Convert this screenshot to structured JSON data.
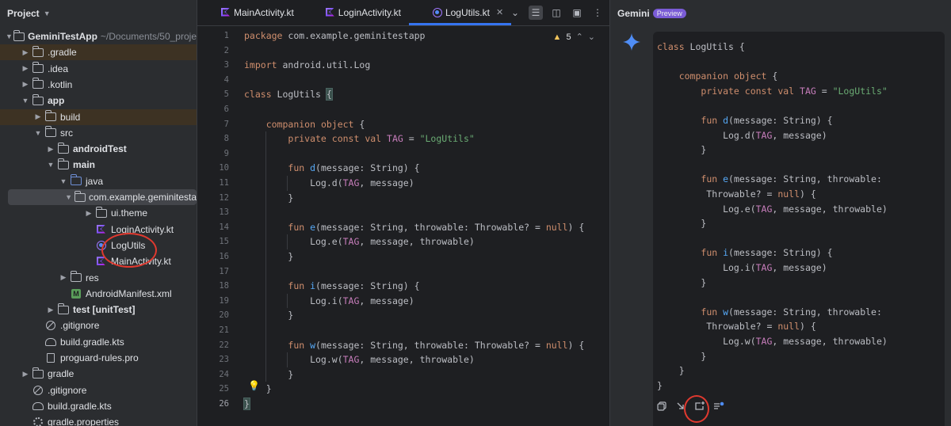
{
  "project_panel": {
    "title": "Project",
    "tree": [
      {
        "label": "GeminiTestApp",
        "path": "~/Documents/50_proje",
        "depth": 0,
        "arrow": "open",
        "icon": "module",
        "bold": true,
        "hl": ""
      },
      {
        "label": ".gradle",
        "depth": 1,
        "arrow": "closed",
        "icon": "folder",
        "hl": "orange"
      },
      {
        "label": ".idea",
        "depth": 1,
        "arrow": "closed",
        "icon": "folder",
        "hl": ""
      },
      {
        "label": ".kotlin",
        "depth": 1,
        "arrow": "closed",
        "icon": "folder",
        "hl": ""
      },
      {
        "label": "app",
        "depth": 1,
        "arrow": "open",
        "icon": "module",
        "bold": true,
        "hl": ""
      },
      {
        "label": "build",
        "depth": 2,
        "arrow": "closed",
        "icon": "folder",
        "hl": "orange"
      },
      {
        "label": "src",
        "depth": 2,
        "arrow": "open",
        "icon": "folder",
        "hl": ""
      },
      {
        "label": "androidTest",
        "depth": 3,
        "arrow": "closed",
        "icon": "folder",
        "bold": true,
        "hl": ""
      },
      {
        "label": "main",
        "depth": 3,
        "arrow": "open",
        "icon": "folder",
        "bold": true,
        "hl": ""
      },
      {
        "label": "java",
        "depth": 4,
        "arrow": "open",
        "icon": "folder-blue",
        "hl": ""
      },
      {
        "label": "com.example.geminitesta",
        "depth": 5,
        "arrow": "open",
        "icon": "folder",
        "hl": "sel"
      },
      {
        "label": "ui.theme",
        "depth": 6,
        "arrow": "closed",
        "icon": "folder",
        "hl": ""
      },
      {
        "label": "LoginActivity.kt",
        "depth": 6,
        "arrow": "none",
        "icon": "kotlin",
        "hl": ""
      },
      {
        "label": "LogUtils",
        "depth": 6,
        "arrow": "none",
        "icon": "object",
        "hl": ""
      },
      {
        "label": "MainActivity.kt",
        "depth": 6,
        "arrow": "none",
        "icon": "kotlin",
        "hl": ""
      },
      {
        "label": "res",
        "depth": 4,
        "arrow": "closed",
        "icon": "folder",
        "hl": ""
      },
      {
        "label": "AndroidManifest.xml",
        "depth": 4,
        "arrow": "none",
        "icon": "manifest",
        "hl": ""
      },
      {
        "label": "test [unitTest]",
        "depth": 3,
        "arrow": "closed",
        "icon": "folder",
        "bold": true,
        "hl": ""
      },
      {
        "label": ".gitignore",
        "depth": 2,
        "arrow": "none",
        "icon": "ban",
        "hl": ""
      },
      {
        "label": "build.gradle.kts",
        "depth": 2,
        "arrow": "none",
        "icon": "gradle",
        "hl": ""
      },
      {
        "label": "proguard-rules.pro",
        "depth": 2,
        "arrow": "none",
        "icon": "file",
        "hl": ""
      },
      {
        "label": "gradle",
        "depth": 1,
        "arrow": "closed",
        "icon": "folder",
        "hl": ""
      },
      {
        "label": ".gitignore",
        "depth": 1,
        "arrow": "none",
        "icon": "ban",
        "hl": ""
      },
      {
        "label": "build.gradle.kts",
        "depth": 1,
        "arrow": "none",
        "icon": "gradle",
        "hl": ""
      },
      {
        "label": "gradle.properties",
        "depth": 1,
        "arrow": "none",
        "icon": "gear",
        "hl": ""
      }
    ]
  },
  "editor": {
    "tabs": [
      {
        "label": "MainActivity.kt",
        "icon": "kotlin",
        "active": false
      },
      {
        "label": "LoginActivity.kt",
        "icon": "kotlin",
        "active": false
      },
      {
        "label": "LogUtils.kt",
        "icon": "object",
        "active": true
      }
    ],
    "close_glyph": "✕",
    "warnings_count": "5",
    "lines": [
      [
        [
          "kw",
          "package "
        ],
        [
          "t",
          "com.example.geminitestapp"
        ]
      ],
      [],
      [
        [
          "kw",
          "import "
        ],
        [
          "t",
          "android.util.Log"
        ]
      ],
      [],
      [
        [
          "kw",
          "class "
        ],
        [
          "t",
          "LogUtils "
        ],
        [
          "hl",
          "{"
        ]
      ],
      [],
      [
        [
          "t",
          "    "
        ],
        [
          "kw",
          "companion object "
        ],
        [
          "t",
          "{"
        ]
      ],
      [
        [
          "t",
          "        "
        ],
        [
          "kw",
          "private const val "
        ],
        [
          "const",
          "TAG"
        ],
        [
          "t",
          " = "
        ],
        [
          "str",
          "\"LogUtils\""
        ]
      ],
      [],
      [
        [
          "t",
          "        "
        ],
        [
          "kw",
          "fun "
        ],
        [
          "fn",
          "d"
        ],
        [
          "t",
          "(message: String) {"
        ]
      ],
      [
        [
          "t",
          "            Log.d("
        ],
        [
          "const",
          "TAG"
        ],
        [
          "t",
          ", message)"
        ]
      ],
      [
        [
          "t",
          "        }"
        ]
      ],
      [],
      [
        [
          "t",
          "        "
        ],
        [
          "kw",
          "fun "
        ],
        [
          "fn",
          "e"
        ],
        [
          "t",
          "(message: String, throwable: Throwable? = "
        ],
        [
          "kw",
          "null"
        ],
        [
          "t",
          ") {"
        ]
      ],
      [
        [
          "t",
          "            Log.e("
        ],
        [
          "const",
          "TAG"
        ],
        [
          "t",
          ", message, throwable)"
        ]
      ],
      [
        [
          "t",
          "        }"
        ]
      ],
      [],
      [
        [
          "t",
          "        "
        ],
        [
          "kw",
          "fun "
        ],
        [
          "fn",
          "i"
        ],
        [
          "t",
          "(message: String) {"
        ]
      ],
      [
        [
          "t",
          "            Log.i("
        ],
        [
          "const",
          "TAG"
        ],
        [
          "t",
          ", message)"
        ]
      ],
      [
        [
          "t",
          "        }"
        ]
      ],
      [],
      [
        [
          "t",
          "        "
        ],
        [
          "kw",
          "fun "
        ],
        [
          "fn",
          "w"
        ],
        [
          "t",
          "(message: String, throwable: Throwable? = "
        ],
        [
          "kw",
          "null"
        ],
        [
          "t",
          ") {"
        ]
      ],
      [
        [
          "t",
          "            Log.w("
        ],
        [
          "const",
          "TAG"
        ],
        [
          "t",
          ", message, throwable)"
        ]
      ],
      [
        [
          "t",
          "        }"
        ]
      ],
      [
        [
          "t",
          "    }"
        ]
      ],
      [
        [
          "hl",
          "}"
        ]
      ]
    ]
  },
  "gemini": {
    "title": "Gemini",
    "badge": "Preview",
    "lines": [
      [
        [
          "kw",
          "class "
        ],
        [
          "t",
          "LogUtils {"
        ]
      ],
      [],
      [
        [
          "t",
          "    "
        ],
        [
          "kw",
          "companion object "
        ],
        [
          "t",
          "{"
        ]
      ],
      [
        [
          "t",
          "        "
        ],
        [
          "kw",
          "private const val "
        ],
        [
          "const",
          "TAG"
        ],
        [
          "t",
          " = "
        ],
        [
          "str",
          "\"LogUtils\""
        ]
      ],
      [],
      [
        [
          "t",
          "        "
        ],
        [
          "kw",
          "fun "
        ],
        [
          "fn",
          "d"
        ],
        [
          "t",
          "(message: String) {"
        ]
      ],
      [
        [
          "t",
          "            Log.d("
        ],
        [
          "const",
          "TAG"
        ],
        [
          "t",
          ", message)"
        ]
      ],
      [
        [
          "t",
          "        }"
        ]
      ],
      [],
      [
        [
          "t",
          "        "
        ],
        [
          "kw",
          "fun "
        ],
        [
          "fn",
          "e"
        ],
        [
          "t",
          "(message: String, throwable:"
        ]
      ],
      [
        [
          "t",
          "         Throwable? = "
        ],
        [
          "kw",
          "null"
        ],
        [
          "t",
          ") {"
        ]
      ],
      [
        [
          "t",
          "            Log.e("
        ],
        [
          "const",
          "TAG"
        ],
        [
          "t",
          ", message, throwable)"
        ]
      ],
      [
        [
          "t",
          "        }"
        ]
      ],
      [],
      [
        [
          "t",
          "        "
        ],
        [
          "kw",
          "fun "
        ],
        [
          "fn",
          "i"
        ],
        [
          "t",
          "(message: String) {"
        ]
      ],
      [
        [
          "t",
          "            Log.i("
        ],
        [
          "const",
          "TAG"
        ],
        [
          "t",
          ", message)"
        ]
      ],
      [
        [
          "t",
          "        }"
        ]
      ],
      [],
      [
        [
          "t",
          "        "
        ],
        [
          "kw",
          "fun "
        ],
        [
          "fn",
          "w"
        ],
        [
          "t",
          "(message: String, throwable:"
        ]
      ],
      [
        [
          "t",
          "         Throwable? = "
        ],
        [
          "kw",
          "null"
        ],
        [
          "t",
          ") {"
        ]
      ],
      [
        [
          "t",
          "            Log.w("
        ],
        [
          "const",
          "TAG"
        ],
        [
          "t",
          ", message, throwable)"
        ]
      ],
      [
        [
          "t",
          "        }"
        ]
      ],
      [
        [
          "t",
          "    }"
        ]
      ],
      [
        [
          "t",
          "}"
        ]
      ]
    ],
    "actions": [
      {
        "name": "copy-icon"
      },
      {
        "name": "insert-at-cursor-icon"
      },
      {
        "name": "new-file-icon"
      },
      {
        "name": "explain-icon"
      }
    ]
  },
  "colors": {
    "accent": "#3574f0",
    "keyword": "#cf8e6d",
    "string": "#6aab73",
    "function": "#56a8f5",
    "constant": "#c77dbb",
    "annotation": "#e0392f"
  }
}
